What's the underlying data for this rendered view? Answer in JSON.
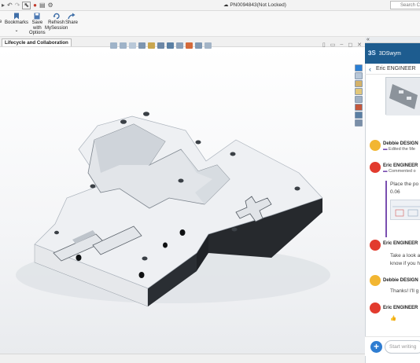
{
  "titlebar": {
    "document_title": "PN0094843(Not Locked)",
    "search_placeholder": "Search Con"
  },
  "ribbon": {
    "buttons": [
      {
        "label": "Bookmarks",
        "icon": "bookmark-icon"
      },
      {
        "label": "Save\nwith\nOptions",
        "icon": "save-options-icon"
      },
      {
        "label": "Refresh\nMySession",
        "icon": "refresh-icon"
      },
      {
        "label": "Share",
        "icon": "share-icon"
      }
    ],
    "partial_left_label": "e"
  },
  "tabs": {
    "active": "Lifecycle and Collaboration"
  },
  "panel": {
    "collapse_glyph": "«",
    "brand": "3DSwym",
    "user": "Eric ENGINEER",
    "feed": [
      {
        "author": "Debbie DESIGN",
        "meta": "Edited the Me",
        "avatar_color": "#f2b632"
      },
      {
        "author": "Eric ENGINEER",
        "meta": "Commented o",
        "body": "Place the po",
        "body2": "0.06",
        "avatar_color": "#e23b2e"
      },
      {
        "author": "Eric ENGINEER",
        "body": "Take a look a",
        "body2": "know if you h",
        "avatar_color": "#e23b2e"
      },
      {
        "author": "Debbie DESIGN",
        "body": "Thanks!  I'll g",
        "avatar_color": "#f2b632"
      },
      {
        "author": "Eric ENGINEER",
        "body": "👍",
        "avatar_color": "#e23b2e"
      }
    ],
    "compose_placeholder": "Start writing"
  },
  "colors": {
    "panel_header": "#1d5c8f",
    "accent_blue": "#2f7dd1",
    "part_face": "#eef0f3",
    "part_side": "#1f2226"
  }
}
